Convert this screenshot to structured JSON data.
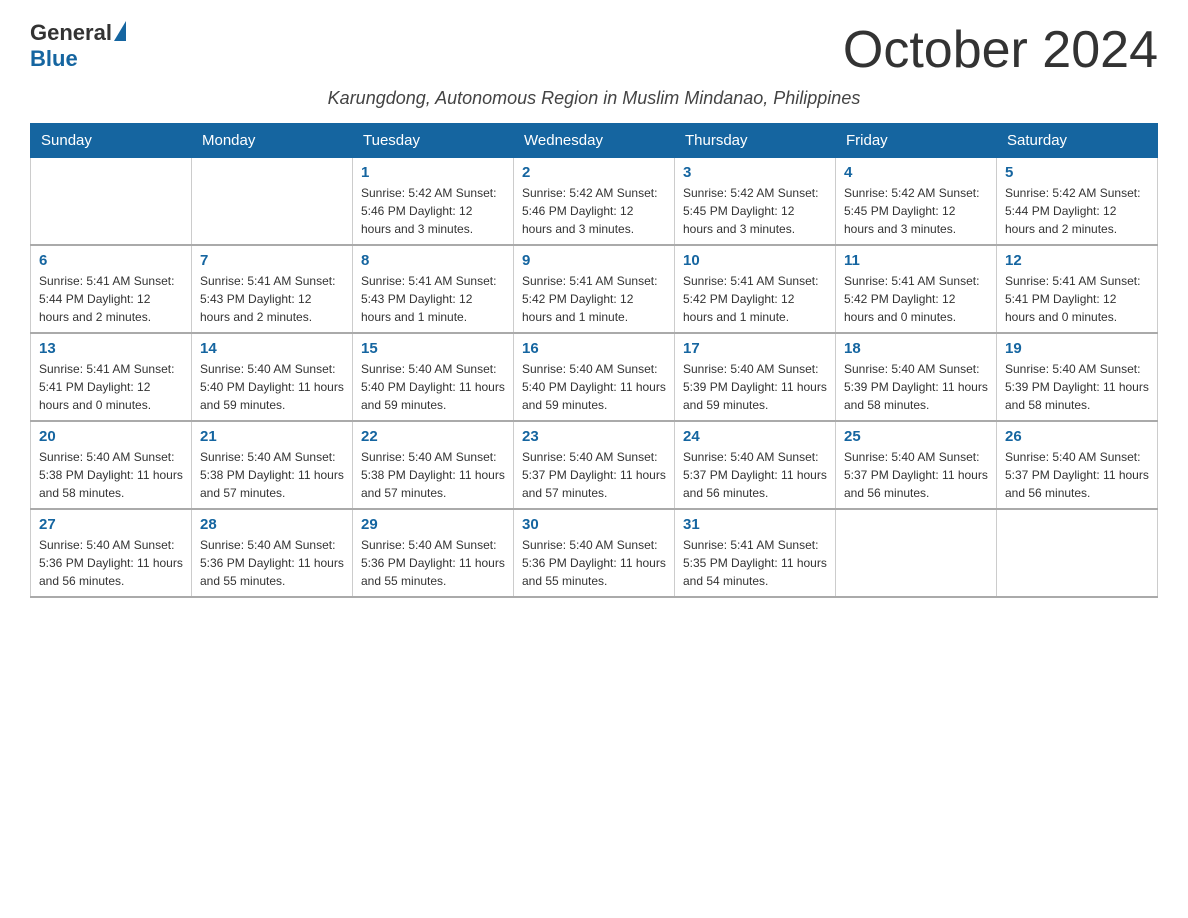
{
  "logo": {
    "general": "General",
    "blue": "Blue"
  },
  "title": "October 2024",
  "subtitle": "Karungdong, Autonomous Region in Muslim Mindanao, Philippines",
  "weekdays": [
    "Sunday",
    "Monday",
    "Tuesday",
    "Wednesday",
    "Thursday",
    "Friday",
    "Saturday"
  ],
  "weeks": [
    [
      {
        "day": "",
        "info": ""
      },
      {
        "day": "",
        "info": ""
      },
      {
        "day": "1",
        "info": "Sunrise: 5:42 AM\nSunset: 5:46 PM\nDaylight: 12 hours and 3 minutes."
      },
      {
        "day": "2",
        "info": "Sunrise: 5:42 AM\nSunset: 5:46 PM\nDaylight: 12 hours and 3 minutes."
      },
      {
        "day": "3",
        "info": "Sunrise: 5:42 AM\nSunset: 5:45 PM\nDaylight: 12 hours and 3 minutes."
      },
      {
        "day": "4",
        "info": "Sunrise: 5:42 AM\nSunset: 5:45 PM\nDaylight: 12 hours and 3 minutes."
      },
      {
        "day": "5",
        "info": "Sunrise: 5:42 AM\nSunset: 5:44 PM\nDaylight: 12 hours and 2 minutes."
      }
    ],
    [
      {
        "day": "6",
        "info": "Sunrise: 5:41 AM\nSunset: 5:44 PM\nDaylight: 12 hours and 2 minutes."
      },
      {
        "day": "7",
        "info": "Sunrise: 5:41 AM\nSunset: 5:43 PM\nDaylight: 12 hours and 2 minutes."
      },
      {
        "day": "8",
        "info": "Sunrise: 5:41 AM\nSunset: 5:43 PM\nDaylight: 12 hours and 1 minute."
      },
      {
        "day": "9",
        "info": "Sunrise: 5:41 AM\nSunset: 5:42 PM\nDaylight: 12 hours and 1 minute."
      },
      {
        "day": "10",
        "info": "Sunrise: 5:41 AM\nSunset: 5:42 PM\nDaylight: 12 hours and 1 minute."
      },
      {
        "day": "11",
        "info": "Sunrise: 5:41 AM\nSunset: 5:42 PM\nDaylight: 12 hours and 0 minutes."
      },
      {
        "day": "12",
        "info": "Sunrise: 5:41 AM\nSunset: 5:41 PM\nDaylight: 12 hours and 0 minutes."
      }
    ],
    [
      {
        "day": "13",
        "info": "Sunrise: 5:41 AM\nSunset: 5:41 PM\nDaylight: 12 hours and 0 minutes."
      },
      {
        "day": "14",
        "info": "Sunrise: 5:40 AM\nSunset: 5:40 PM\nDaylight: 11 hours and 59 minutes."
      },
      {
        "day": "15",
        "info": "Sunrise: 5:40 AM\nSunset: 5:40 PM\nDaylight: 11 hours and 59 minutes."
      },
      {
        "day": "16",
        "info": "Sunrise: 5:40 AM\nSunset: 5:40 PM\nDaylight: 11 hours and 59 minutes."
      },
      {
        "day": "17",
        "info": "Sunrise: 5:40 AM\nSunset: 5:39 PM\nDaylight: 11 hours and 59 minutes."
      },
      {
        "day": "18",
        "info": "Sunrise: 5:40 AM\nSunset: 5:39 PM\nDaylight: 11 hours and 58 minutes."
      },
      {
        "day": "19",
        "info": "Sunrise: 5:40 AM\nSunset: 5:39 PM\nDaylight: 11 hours and 58 minutes."
      }
    ],
    [
      {
        "day": "20",
        "info": "Sunrise: 5:40 AM\nSunset: 5:38 PM\nDaylight: 11 hours and 58 minutes."
      },
      {
        "day": "21",
        "info": "Sunrise: 5:40 AM\nSunset: 5:38 PM\nDaylight: 11 hours and 57 minutes."
      },
      {
        "day": "22",
        "info": "Sunrise: 5:40 AM\nSunset: 5:38 PM\nDaylight: 11 hours and 57 minutes."
      },
      {
        "day": "23",
        "info": "Sunrise: 5:40 AM\nSunset: 5:37 PM\nDaylight: 11 hours and 57 minutes."
      },
      {
        "day": "24",
        "info": "Sunrise: 5:40 AM\nSunset: 5:37 PM\nDaylight: 11 hours and 56 minutes."
      },
      {
        "day": "25",
        "info": "Sunrise: 5:40 AM\nSunset: 5:37 PM\nDaylight: 11 hours and 56 minutes."
      },
      {
        "day": "26",
        "info": "Sunrise: 5:40 AM\nSunset: 5:37 PM\nDaylight: 11 hours and 56 minutes."
      }
    ],
    [
      {
        "day": "27",
        "info": "Sunrise: 5:40 AM\nSunset: 5:36 PM\nDaylight: 11 hours and 56 minutes."
      },
      {
        "day": "28",
        "info": "Sunrise: 5:40 AM\nSunset: 5:36 PM\nDaylight: 11 hours and 55 minutes."
      },
      {
        "day": "29",
        "info": "Sunrise: 5:40 AM\nSunset: 5:36 PM\nDaylight: 11 hours and 55 minutes."
      },
      {
        "day": "30",
        "info": "Sunrise: 5:40 AM\nSunset: 5:36 PM\nDaylight: 11 hours and 55 minutes."
      },
      {
        "day": "31",
        "info": "Sunrise: 5:41 AM\nSunset: 5:35 PM\nDaylight: 11 hours and 54 minutes."
      },
      {
        "day": "",
        "info": ""
      },
      {
        "day": "",
        "info": ""
      }
    ]
  ]
}
